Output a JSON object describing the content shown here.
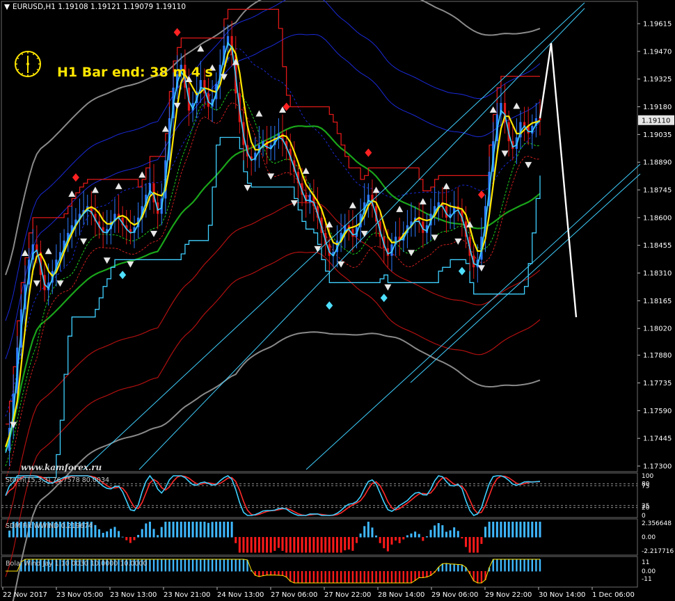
{
  "chart_data": {
    "type": "candlestick",
    "symbol_line": "EURUSD,H1  1.19108 1.19121 1.19079 1.19110",
    "timer_text": "H1 Bar end: 38 m 4 s",
    "watermark": "www.kamforex.ru",
    "price_axis": {
      "ylim": [
        1.1727,
        1.1965
      ],
      "ticks": [
        "1.19615",
        "1.19470",
        "1.19325",
        "1.19180",
        "1.19035",
        "1.18890",
        "1.18745",
        "1.18600",
        "1.18455",
        "1.18310",
        "1.18165",
        "1.18020",
        "1.17880",
        "1.17735",
        "1.17590",
        "1.17445",
        "1.17300"
      ],
      "current_price": "1.19110"
    },
    "time_axis": {
      "labels": [
        "22 Nov 2017",
        "23 Nov 05:00",
        "23 Nov 13:00",
        "23 Nov 21:00",
        "24 Nov 13:00",
        "27 Nov 06:00",
        "27 Nov 22:00",
        "28 Nov 14:00",
        "29 Nov 06:00",
        "29 Nov 22:00",
        "30 Nov 14:00",
        "1 Dec 06:00"
      ]
    },
    "close_path": [
      1.1738,
      1.175,
      1.1768,
      1.1792,
      1.1812,
      1.1825,
      1.1838,
      1.1846,
      1.1842,
      1.183,
      1.1822,
      1.1826,
      1.1832,
      1.1838,
      1.1842,
      1.1848,
      1.1852,
      1.1856,
      1.1859,
      1.1862,
      1.1864,
      1.1866,
      1.1862,
      1.1858,
      1.1855,
      1.1852,
      1.1854,
      1.1858,
      1.1862,
      1.186,
      1.1856,
      1.1854,
      1.1852,
      1.1855,
      1.186,
      1.1866,
      1.1872,
      1.1878,
      1.1868,
      1.1862,
      1.187,
      1.189,
      1.1912,
      1.1928,
      1.1935,
      1.194,
      1.1928,
      1.1916,
      1.192,
      1.1926,
      1.1932,
      1.1925,
      1.1918,
      1.1922,
      1.193,
      1.194,
      1.195,
      1.1955,
      1.1945,
      1.1925,
      1.191,
      1.1898,
      1.1892,
      1.189,
      1.1894,
      1.1898,
      1.19,
      1.1896,
      1.1898,
      1.1902,
      1.1904,
      1.19,
      1.1896,
      1.189,
      1.1884,
      1.1878,
      1.1872,
      1.1868,
      1.1872,
      1.1866,
      1.186,
      1.1852,
      1.1846,
      1.184,
      1.1842,
      1.1848,
      1.1852,
      1.1856,
      1.1854,
      1.185,
      1.1855,
      1.1862,
      1.1868,
      1.1872,
      1.1866,
      1.1858,
      1.185,
      1.1844,
      1.184,
      1.1846,
      1.185,
      1.1848,
      1.1852,
      1.1856,
      1.1858,
      1.186,
      1.1858,
      1.1852,
      1.1856,
      1.1862,
      1.1866,
      1.1868,
      1.1866,
      1.186,
      1.1862,
      1.1866,
      1.1864,
      1.1858,
      1.185,
      1.184,
      1.1834,
      1.1838,
      1.185,
      1.1866,
      1.1884,
      1.19,
      1.1914,
      1.192,
      1.191,
      1.19,
      1.1896,
      1.1902,
      1.191,
      1.1908,
      1.1904,
      1.1908,
      1.1912,
      1.1911
    ],
    "indicators": {
      "stoch_label": "Stoch(15,3,3) 76.7578 80.0034",
      "stoch_ticks": [
        "100",
        "80",
        "75",
        "25",
        "20",
        "0"
      ],
      "hist1_label": "SDM Fix WWIND 0.219674",
      "hist1_ticks": [
        "2.356648",
        "0.00",
        "-2.217716"
      ],
      "hist2_label": "Bolal Wind Jay 1.10 0030 10.0000 10.0000",
      "hist2_ticks": [
        "11",
        "0.00",
        "-11"
      ]
    },
    "colors": {
      "background": "#000000",
      "up_candle": "#2d7bff",
      "down_candle": "#e01818",
      "yellow_ma": "#ffe600",
      "cyan": "#3fd0ff",
      "red_channel": "#e01818",
      "green_ma": "#1aa51a",
      "gray_band": "#8a8a8a",
      "dark_blue_band": "#1a2ad8",
      "white_proj": "#ffffff",
      "hist_up": "#3fb8ff",
      "hist_down": "#ff1a1a"
    }
  }
}
